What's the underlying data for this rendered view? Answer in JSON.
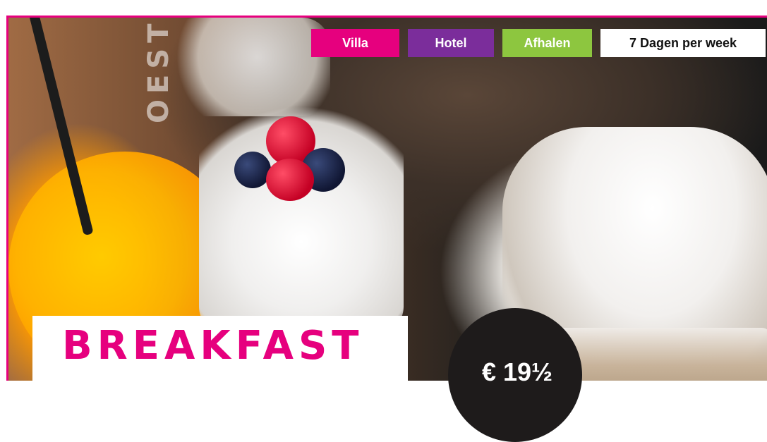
{
  "tags": [
    {
      "label": "Villa",
      "color": "#e6007e"
    },
    {
      "label": "Hotel",
      "color": "#7b2d9b"
    },
    {
      "label": "Afhalen",
      "color": "#8dc63f"
    },
    {
      "label": "7 Dagen per week",
      "color": "#ffffff"
    }
  ],
  "hero": {
    "headline": "BREAKFAST",
    "price": "€ 19½"
  },
  "brand": {
    "accent": "#e6007e",
    "glass_print": "OESTERDA"
  }
}
